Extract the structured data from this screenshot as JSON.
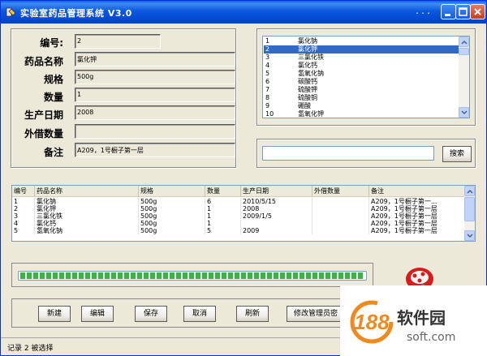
{
  "window": {
    "title": "实验室药品管理系统 V3.0",
    "title_extra": "...",
    "controls": [
      "minimize",
      "maximize",
      "close"
    ]
  },
  "form": {
    "fields": [
      {
        "label": "编号:",
        "value": "2"
      },
      {
        "label": "药品名称",
        "value": "氯化钾"
      },
      {
        "label": "规格",
        "value": "500g"
      },
      {
        "label": "数量",
        "value": "1"
      },
      {
        "label": "生产日期",
        "value": "2008"
      },
      {
        "label": "外借数量",
        "value": ""
      },
      {
        "label": "备注",
        "value": "A209，1号橱子第一层"
      }
    ]
  },
  "drug_list": {
    "selected_index": 1,
    "items": [
      {
        "n": "1",
        "name": "氯化钠"
      },
      {
        "n": "2",
        "name": "氯化钾"
      },
      {
        "n": "3",
        "name": "三氯化铁"
      },
      {
        "n": "4",
        "name": "氯化钙"
      },
      {
        "n": "5",
        "name": "氢氧化钠"
      },
      {
        "n": "6",
        "name": "碳酸钙"
      },
      {
        "n": "7",
        "name": "硫酸钾"
      },
      {
        "n": "8",
        "name": "硫酸铜"
      },
      {
        "n": "9",
        "name": "硼酸"
      },
      {
        "n": "10",
        "name": "氢氧化钾"
      }
    ]
  },
  "search": {
    "value": "",
    "button": "搜索"
  },
  "table": {
    "columns": [
      "编号",
      "药品名称",
      "规格",
      "数量",
      "生产日期",
      "外借数量",
      "备注"
    ],
    "rows": [
      [
        "1",
        "氯化钠",
        "500g",
        "6",
        "2010/5/15",
        "",
        "A209，1号橱子第一..."
      ],
      [
        "2",
        "氯化钾",
        "500g",
        "1",
        "2008",
        "",
        "A209，1号橱子第一层"
      ],
      [
        "3",
        "三氯化铁",
        "500g",
        "1",
        "2009/1/5",
        "",
        "A209，1号橱子第一层"
      ],
      [
        "4",
        "氯化钙",
        "500g",
        "1",
        "",
        "",
        "A209，1号橱子第一层"
      ],
      [
        "5",
        "氢氧化钠",
        "500g",
        "5",
        "2009",
        "",
        "A209，1号橱子第一层"
      ]
    ]
  },
  "progress": {
    "fraction": 1.0
  },
  "buttons": {
    "new": "新建",
    "edit": "编辑",
    "save": "保存",
    "cancel": "取消",
    "refresh": "刷新",
    "change_password": "修改管理员密"
  },
  "status": {
    "text": "记录 2  被选择"
  },
  "watermark": {
    "brand": "软件园",
    "url": "soft.com",
    "number": "188"
  }
}
